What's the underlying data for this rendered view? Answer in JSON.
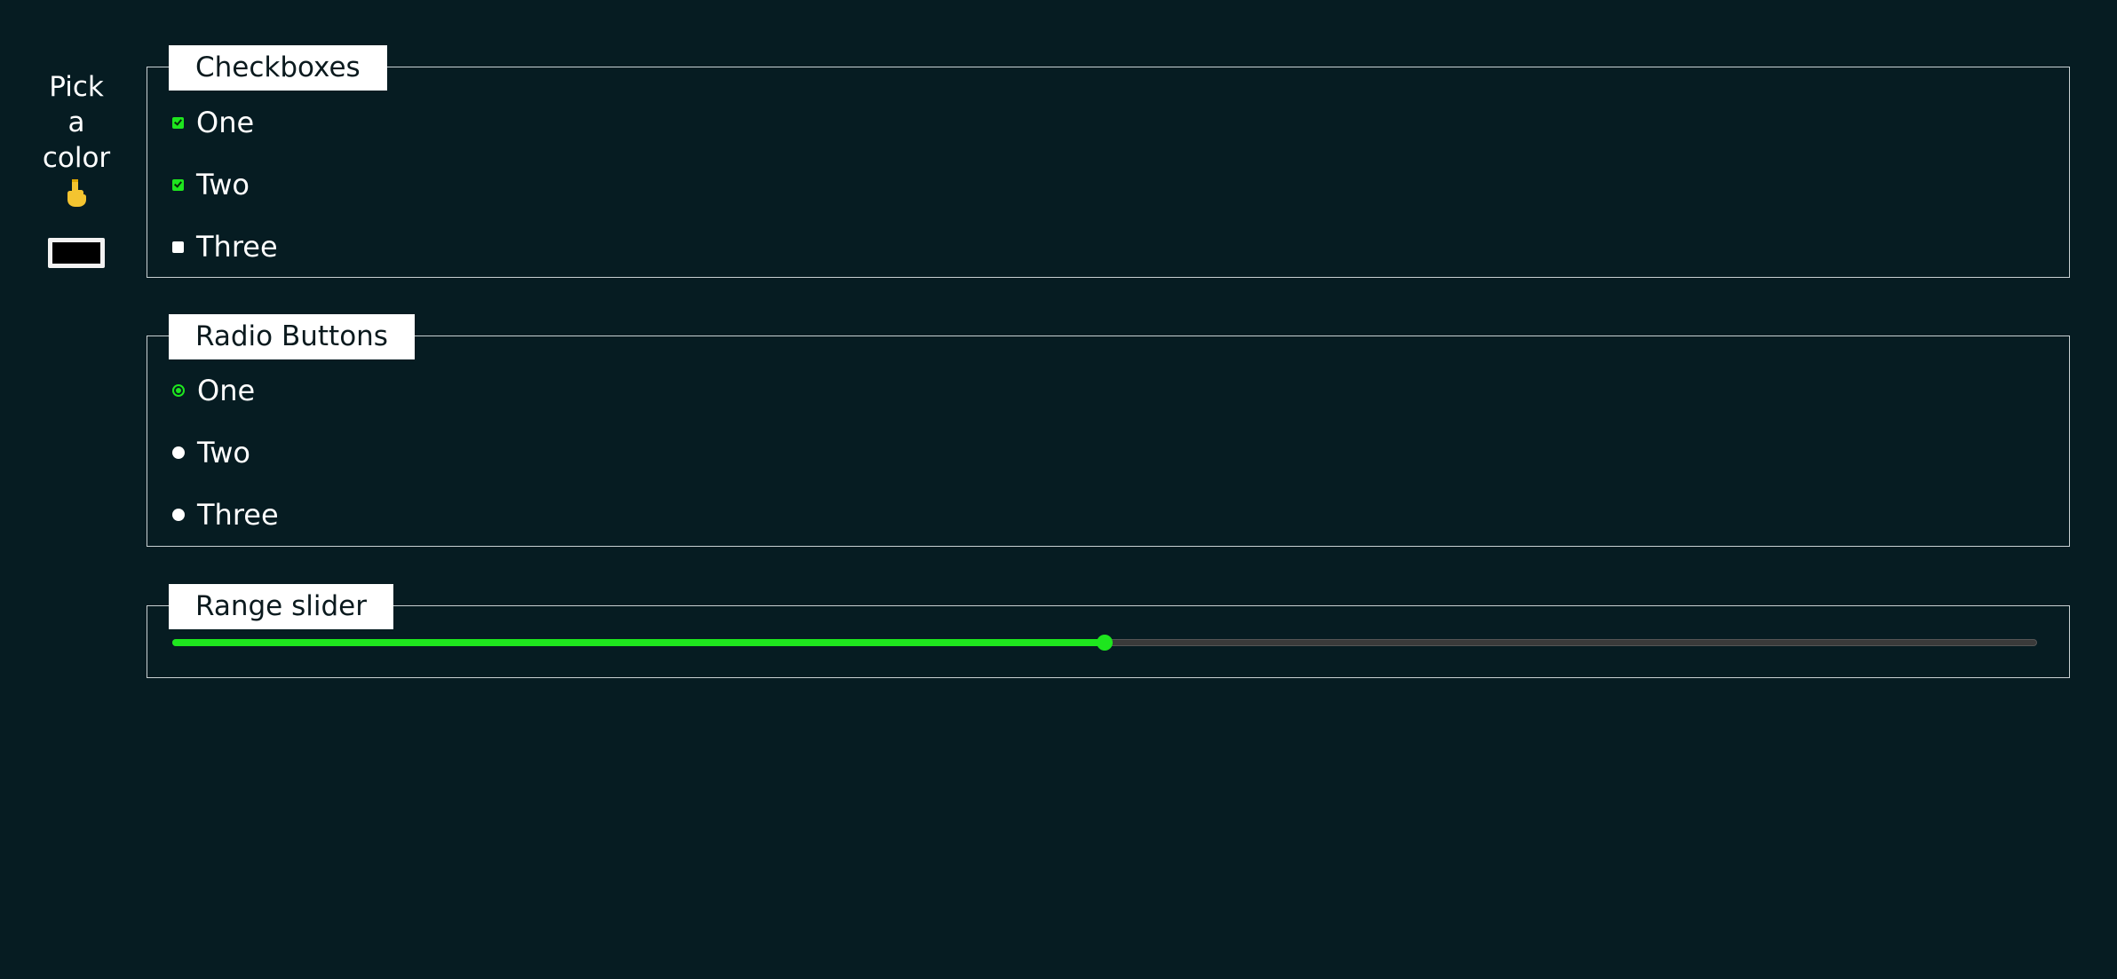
{
  "picker": {
    "label_lines": [
      "Pick",
      "a",
      "color"
    ],
    "icon": "hand-pointing-down-icon",
    "swatch_color": "#000000"
  },
  "checkboxes": {
    "legend": "Checkboxes",
    "items": [
      {
        "label": "One",
        "checked": true
      },
      {
        "label": "Two",
        "checked": true
      },
      {
        "label": "Three",
        "checked": false
      }
    ]
  },
  "radios": {
    "legend": "Radio Buttons",
    "items": [
      {
        "label": "One",
        "selected": true
      },
      {
        "label": "Two",
        "selected": false
      },
      {
        "label": "Three",
        "selected": false
      }
    ]
  },
  "range": {
    "legend": "Range slider",
    "value_fraction": 0.5
  },
  "colors": {
    "background": "#061c22",
    "accent": "#1ee61e",
    "border": "#c9d1d3",
    "legend_bg": "#ffffff"
  }
}
